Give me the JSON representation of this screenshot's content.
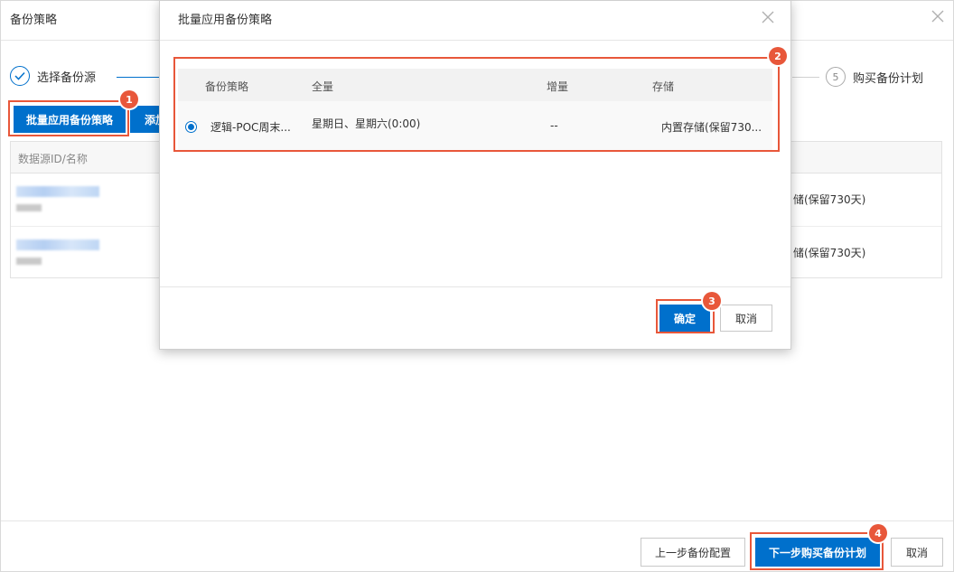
{
  "panel": {
    "title": "备份策略",
    "steps": {
      "step1_label": "选择备份源",
      "step5_number": "5",
      "step5_label": "购买备份计划"
    },
    "toolbar": {
      "batch_apply_label": "批量应用备份策略",
      "add_label": "添加"
    },
    "table": {
      "header": "数据源ID/名称",
      "rows": [
        {
          "storage": "储(保留730天)"
        },
        {
          "storage": "储(保留730天)"
        }
      ]
    },
    "footer": {
      "prev_label": "上一步备份配置",
      "next_label": "下一步购买备份计划",
      "cancel_label": "取消"
    }
  },
  "modal": {
    "title": "批量应用备份策略",
    "columns": {
      "policy": "备份策略",
      "full": "全量",
      "incremental": "增量",
      "storage": "存储"
    },
    "policy_row": {
      "name": "逻辑-POC周末...",
      "full": "星期日、星期六(0:00)",
      "incremental": "--",
      "storage": "内置存储(保留730..."
    },
    "ok_label": "确定",
    "cancel_label": "取消"
  },
  "badges": [
    "1",
    "2",
    "3",
    "4"
  ],
  "colors": {
    "primary": "#0070cc",
    "highlight": "#e8573a"
  }
}
